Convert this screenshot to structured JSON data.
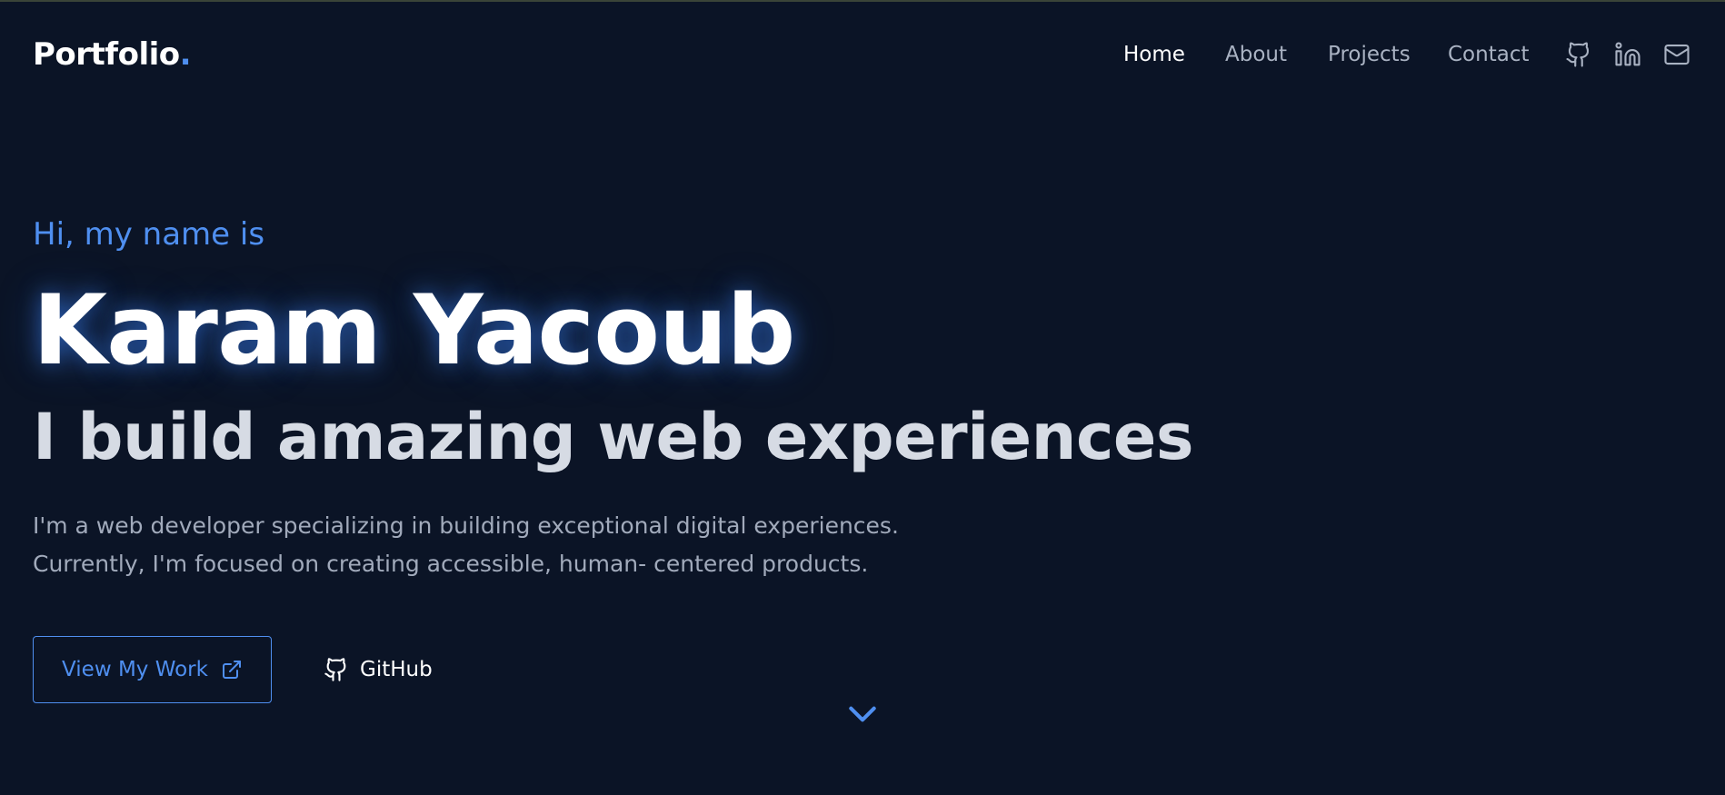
{
  "brand": {
    "logo_text": "Portfolio",
    "logo_dot": ".",
    "accent_color": "#4f8ff0"
  },
  "nav": {
    "items": [
      {
        "label": "Home",
        "active": true
      },
      {
        "label": "About",
        "active": false
      },
      {
        "label": "Projects",
        "active": false
      },
      {
        "label": "Contact",
        "active": false
      }
    ],
    "social_icons": [
      "github-icon",
      "linkedin-icon",
      "mail-icon"
    ]
  },
  "hero": {
    "greeting": "Hi, my name is",
    "name": "Karam Yacoub",
    "tagline": "I build amazing web experiences",
    "intro_lines": [
      "I'm a web developer specializing in building exceptional digital experiences.",
      "Currently, I'm focused on creating accessible, human- centered products."
    ],
    "primary_button": {
      "label": "View My Work",
      "icon": "external-link-icon"
    },
    "secondary_button": {
      "label": "GitHub",
      "icon": "github-icon"
    },
    "scroll_icon": "chevron-down-icon"
  },
  "colors": {
    "background": "#0b1426",
    "text": "#ffffff",
    "muted_text": "#a1aabb",
    "tagline": "#d6dbe4"
  }
}
